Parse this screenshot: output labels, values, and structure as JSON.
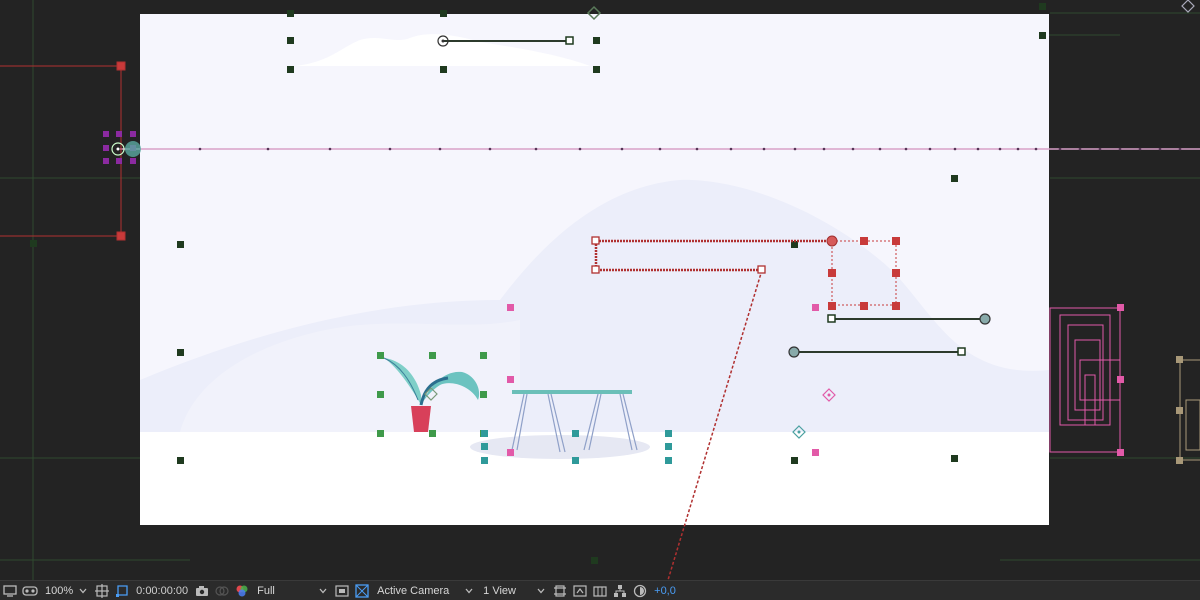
{
  "window": "Composition viewer",
  "colors": {
    "background": "#232323",
    "canvas": "#f6f6fd",
    "hills": "#eceefa",
    "floor": "#ffffff",
    "null_handle": "#1f3a1f",
    "selected_layer": "#b03030",
    "shape_handle": "#e25aa8",
    "plant_handle": "#3f9a4a",
    "table_handle": "#2f9a9a",
    "accent_blue": "#4a9df5",
    "purple_handle": "#8b2aa0"
  },
  "toolbar": {
    "zoom": "100%",
    "timecode": "0:00:00:00",
    "resolution": "Full",
    "camera": "Active Camera",
    "view_layout": "1 View",
    "exposure": "+0,0",
    "icons": [
      "monitor-icon",
      "vr-goggles-icon",
      "grid-guides-icon",
      "mask-visibility-icon",
      "snapshot-camera-icon",
      "show-snapshot-icon",
      "color-channels-icon",
      "region-of-interest-icon",
      "transparency-grid-icon",
      "reset-view-icon",
      "fast-preview-icon",
      "timeline-icon",
      "flowchart-icon",
      "exposure-reset-icon"
    ]
  }
}
